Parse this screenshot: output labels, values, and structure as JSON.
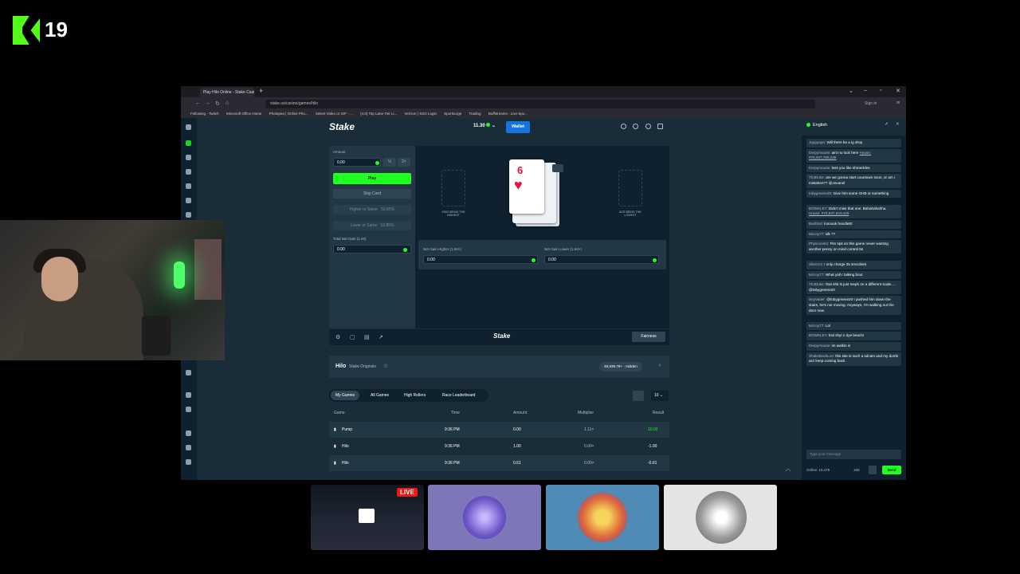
{
  "overlay": {
    "channel_number": "19"
  },
  "browser": {
    "tab_title": "Play Hilo Online - Stake Casi",
    "url": "stake.us/casino/games/hilo",
    "bookmarks": [
      "Following - Twitch",
      "Microsoft Office Home",
      "Photopea | Online Pho...",
      "Select Video or GIF - ...",
      "(4,0) Top Lane Tier Li...",
      "Verizon | SSO Login",
      "Sportsurge",
      "Trading",
      "Buffstreams - Live Spo..."
    ],
    "sign_in": "Sign in"
  },
  "header": {
    "logo": "Stake",
    "balance": "11.30",
    "wallet": "Wallet"
  },
  "bet": {
    "amount_label": "Amount",
    "amount_value": "0.00",
    "half": "½",
    "double": "2×",
    "play": "Play",
    "skip": "Skip Card",
    "higher_label": "Higher or Same",
    "higher_pct": "53.85%",
    "lower_label": "Lower or Same",
    "lower_pct": "53.85%",
    "total_label": "Total Net Gain (1.00)",
    "total_value": "0.00"
  },
  "board": {
    "card_rank": "6",
    "card_suit": "♥",
    "king_label": "KING BEING THE HIGHEST",
    "ace_label": "ACE BEING THE LOWEST",
    "gain_higher_label": "Net Gain Higher (1.84×)",
    "gain_higher_value": "0.00",
    "gain_lower_label": "Net Gain Lower (1.84×)",
    "gain_lower_value": "0.00"
  },
  "toolbar": {
    "logo": "Stake",
    "fairness": "Fairness"
  },
  "info": {
    "title": "Hilo",
    "subtitle": "Stake Originals",
    "players": "49,939.79+",
    "hidden": "Hidden"
  },
  "tabs": [
    "My Games",
    "All Games",
    "High Rollers",
    "Race Leaderboard"
  ],
  "page_size": "10",
  "table": {
    "headers": [
      "Game",
      "Time",
      "Amount",
      "Multiplier",
      "Result"
    ],
    "rows": [
      {
        "game": "Pump",
        "time": "9:36 PM",
        "amount": "0.00",
        "multiplier": "1.11×",
        "result": "10.02"
      },
      {
        "game": "Hilo",
        "time": "9:36 PM",
        "amount": "1.00",
        "multiplier": "0.00×",
        "result": "-1.00"
      },
      {
        "game": "Hilo",
        "time": "9:36 PM",
        "amount": "0.61",
        "multiplier": "0.00×",
        "result": "-0.61"
      }
    ]
  },
  "chat": {
    "language": "English",
    "messages": [
      {
        "user": "Jayguapo:",
        "text": "Will there be a ig drop"
      },
      {
        "user": "Derpymouse:",
        "text": "aint no luck here",
        "link": "House: #75,937,786,238"
      },
      {
        "user": "Derpymouse:",
        "text": "less you like shmeckles"
      },
      {
        "user": "Th3Duke:",
        "text": "are we gonna start countown soon, or am i mistaken?? @Jovanel"
      },
      {
        "user": "tobygreene20:",
        "text": "Give him some GHB or something"
      },
      {
        "user": "BOWKLEY:",
        "text": "Didn't miss that one. Bahahahahha.",
        "link": "House: #75,937,843,429"
      },
      {
        "user": "Bashlnd:",
        "text": "loooook handleEr"
      },
      {
        "user": "Mccoy77:",
        "text": "idk ??"
      },
      {
        "user": "Physcoonto:",
        "text": "Fkn spit on this game never wasting another penny on mind control bs"
      },
      {
        "user": "Silver13:",
        "text": "I only charge 25 smeckles"
      },
      {
        "user": "Mccoy77:",
        "text": "What yall r talking bout"
      },
      {
        "user": "Th3Duke:",
        "text": "that shit is just meph on a different scale.... @tobygreene20"
      },
      {
        "user": "SoyVader:",
        "text": "@tobygreene20 I pushed him down the stairs, he's not moving. Anyways, I'm walking out the door now."
      },
      {
        "user": "Mccoy77:",
        "text": "Lol"
      },
      {
        "user": "BOWKLEY:",
        "text": "Eat shyt n dye beach!"
      },
      {
        "user": "Derpymouse:",
        "text": "im walkin in"
      },
      {
        "user": "ShakeBackLos:",
        "text": "this site is such a sdcam and my dumb azz keep coming back"
      }
    ],
    "placeholder": "Type your message",
    "online": "Online: 19,475",
    "count": "160",
    "send": "Send"
  },
  "thumbnails": {
    "live_badge": "LIVE"
  },
  "colors": {
    "brand_green": "#1fff20",
    "kick_green": "#53fc18",
    "wallet_blue": "#1475e1",
    "bg": "#1a2c38",
    "card_red": "#e9113c"
  }
}
